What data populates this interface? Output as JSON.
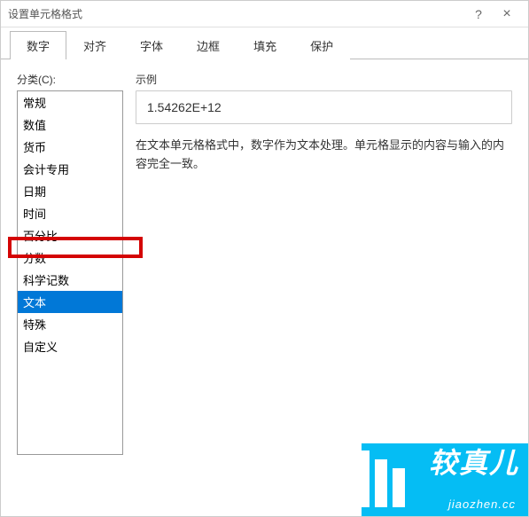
{
  "dialog": {
    "title": "设置单元格格式"
  },
  "tabs": {
    "items": [
      {
        "label": "数字"
      },
      {
        "label": "对齐"
      },
      {
        "label": "字体"
      },
      {
        "label": "边框"
      },
      {
        "label": "填充"
      },
      {
        "label": "保护"
      }
    ],
    "active_index": 0
  },
  "category": {
    "label": "分类(C):",
    "items": [
      "常规",
      "数值",
      "货币",
      "会计专用",
      "日期",
      "时间",
      "百分比",
      "分数",
      "科学记数",
      "文本",
      "特殊",
      "自定义"
    ],
    "selected_index": 9
  },
  "example": {
    "label": "示例",
    "value": "1.54262E+12"
  },
  "description": "在文本单元格格式中，数字作为文本处理。单元格显示的内容与输入的内容完全一致。",
  "watermark": {
    "text": "较真儿",
    "sub": "jiaozhen.cc"
  }
}
